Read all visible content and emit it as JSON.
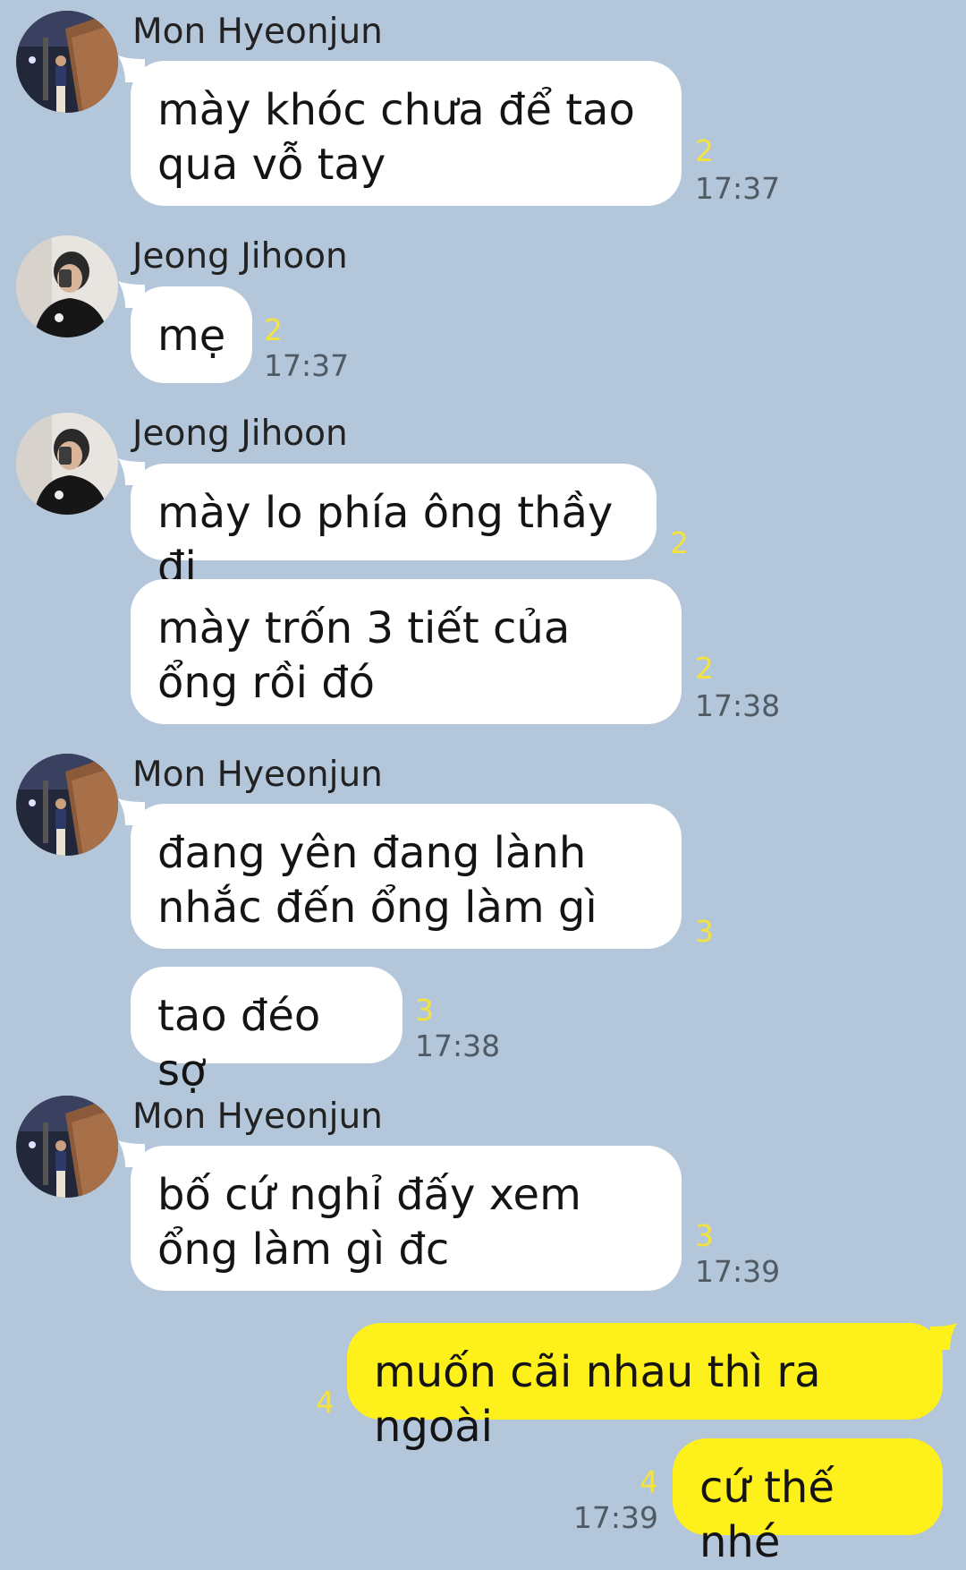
{
  "colors": {
    "background": "#b3c6da",
    "incoming_bubble": "#ffffff",
    "outgoing_bubble": "#fef01b",
    "unread_count": "#f4e33c",
    "timestamp": "#505a64"
  },
  "senders": {
    "mon": {
      "name": "Mon Hyeonjun",
      "avatar_icon": "night-street-photo-avatar"
    },
    "jeong": {
      "name": "Jeong Jihoon",
      "avatar_icon": "mirror-selfie-avatar"
    }
  },
  "messages": [
    {
      "sender": "Mon Hyeonjun",
      "text": "mày khóc chưa để tao qua vỗ tay",
      "unread": "2",
      "time": "17:37"
    },
    {
      "sender": "Jeong Jihoon",
      "text": "mẹ",
      "unread": "2",
      "time": "17:37"
    },
    {
      "sender": "Jeong Jihoon",
      "text": "mày lo phía ông thầy đi",
      "unread": "2",
      "time": ""
    },
    {
      "sender": "Jeong Jihoon",
      "text": "mày trốn 3 tiết của ổng rồi đó",
      "unread": "2",
      "time": "17:38"
    },
    {
      "sender": "Mon Hyeonjun",
      "text": "đang yên đang lành nhắc đến ổng làm gì",
      "unread": "3",
      "time": ""
    },
    {
      "sender": "Mon Hyeonjun",
      "text": "tao đéo sợ",
      "unread": "3",
      "time": "17:38"
    },
    {
      "sender": "Mon Hyeonjun",
      "text": "bố cứ nghỉ đấy xem ổng làm gì đc",
      "unread": "3",
      "time": "17:39"
    },
    {
      "sender": "me",
      "text": "muốn cãi nhau thì ra ngoài",
      "unread": "4",
      "time": ""
    },
    {
      "sender": "me",
      "text": "cứ thế nhé",
      "unread": "4",
      "time": "17:39"
    }
  ]
}
